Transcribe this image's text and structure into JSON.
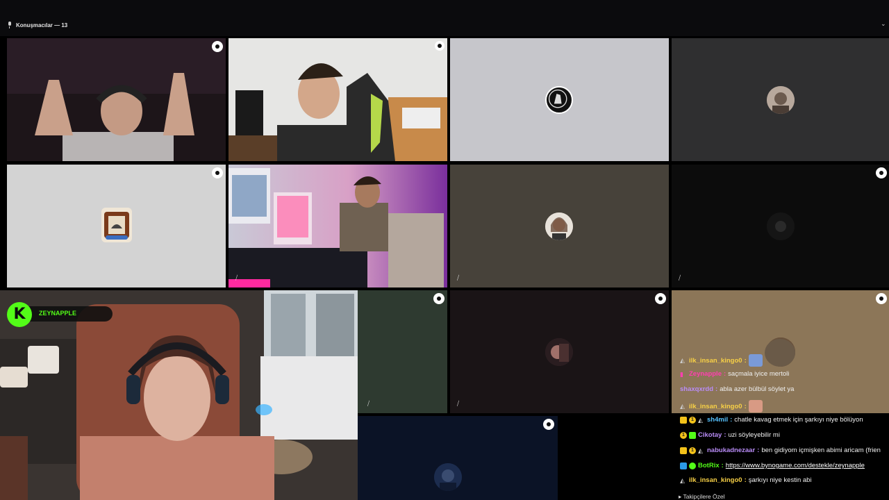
{
  "header": {
    "speakers_label": "Konuşmacılar — 13"
  },
  "streamer": {
    "name": "ZEYNAPPLE",
    "logo_letter": "K"
  },
  "colors": {
    "kick_green": "#53fc18",
    "active_speaker_outline": "#5ac25a"
  },
  "chat": {
    "messages": [
      {
        "user": "ilk_insan_kingo0",
        "color": "#f7d046",
        "text": "",
        "badges": [
          "og-icon"
        ],
        "emote": true
      },
      {
        "user": "Zeynapple",
        "color": "#ff3fb0",
        "text": "saçmala iyice mertoli",
        "badges": [
          "mic-icon"
        ]
      },
      {
        "user": "shaxqxrdd",
        "color": "#b98cf7",
        "text": "abla azer bülbül söylet ya",
        "badges": []
      },
      {
        "user": "ilk_insan_kingo0",
        "color": "#f7d046",
        "text": "",
        "badges": [
          "og-icon"
        ],
        "emote": true
      },
      {
        "user": "sh4mil",
        "color": "#56c2ff",
        "text": "chatle kavag etmek için şarkıyı niye bölüyon",
        "badges": [
          "crown-icon",
          "sub-icon",
          "og-icon"
        ]
      },
      {
        "user": "Cikotay",
        "color": "#b98cf7",
        "text": "uzi söyleyebilir mi",
        "badges": [
          "sub-icon",
          "gift-icon"
        ]
      },
      {
        "user": "nabukadnezaar",
        "color": "#b98cf7",
        "text": "ben gidiyom içmişken abimi aricam (frien",
        "badges": [
          "crown-icon",
          "sub-icon",
          "og-icon"
        ]
      },
      {
        "user": "BotRix",
        "color": "#53fc18",
        "text": "",
        "link": "https://www.bynogame.com/destekle/zeynapple",
        "badges": [
          "bot-icon",
          "verified-icon"
        ]
      },
      {
        "user": "ilk_insan_kingo0",
        "color": "#f7d046",
        "text": "şarkıyı niye kestin abi",
        "badges": [
          "og-icon"
        ]
      }
    ],
    "footer": "Takipçilere Özel"
  }
}
